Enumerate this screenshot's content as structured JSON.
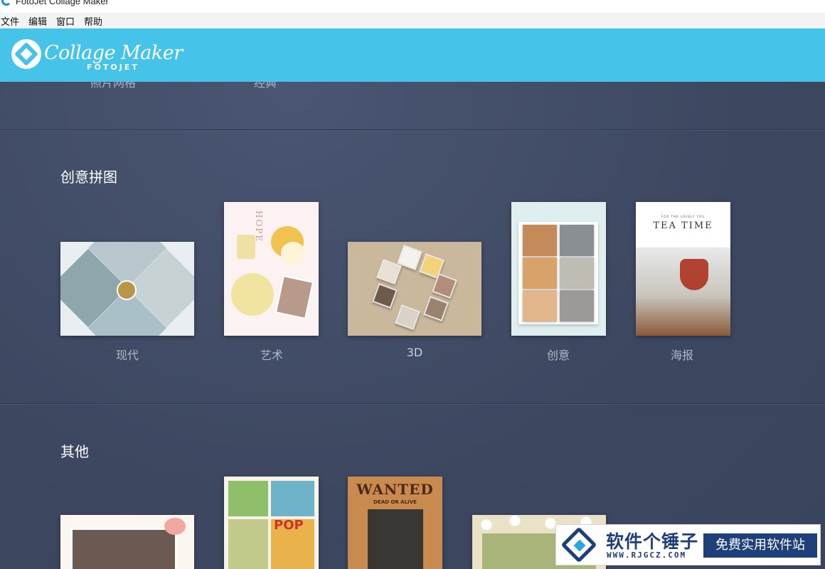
{
  "window": {
    "title": "FotoJet Collage Maker",
    "icon": "fotojet-app-icon"
  },
  "menubar": {
    "items": [
      {
        "label": "文件"
      },
      {
        "label": "编辑"
      },
      {
        "label": "窗口"
      },
      {
        "label": "帮助"
      }
    ]
  },
  "header": {
    "brand_color": "#45c3e8",
    "logo_name": "Collage Maker",
    "logo_sub": "FOTOJET"
  },
  "content": {
    "background": "#3f4a62",
    "clipped_top_labels": [
      "照片网格",
      "经典"
    ],
    "sections": [
      {
        "title": "创意拼图",
        "templates": [
          {
            "label": "现代",
            "thumbnail": "modern-collage"
          },
          {
            "label": "艺术",
            "thumbnail": "art-collage"
          },
          {
            "label": "3D",
            "thumbnail": "3d-collage"
          },
          {
            "label": "创意",
            "thumbnail": "creative-collage"
          },
          {
            "label": "海报",
            "thumbnail": "poster-collage"
          }
        ]
      },
      {
        "title": "其他",
        "templates": [
          {
            "label": "",
            "thumbnail": "wedding-collage"
          },
          {
            "label": "",
            "thumbnail": "comic-collage"
          },
          {
            "label": "",
            "thumbnail": "wanted-poster"
          },
          {
            "label": "",
            "thumbnail": "daisy-collage"
          }
        ]
      }
    ]
  },
  "thumbnails_text": {
    "art_hope": "HOPE",
    "poster_tag": "FOR THE LOVELY YOU",
    "poster_title": "TEA TIME",
    "wanted_title": "WANTED",
    "wanted_sub": "DEAD OR ALIVE",
    "comic_word": "POP"
  },
  "watermark": {
    "main": "软件个锤子",
    "url": "WWW.RJGCZ.COM",
    "slogan": "免费实用软件站",
    "color": "#1f3f7a"
  }
}
